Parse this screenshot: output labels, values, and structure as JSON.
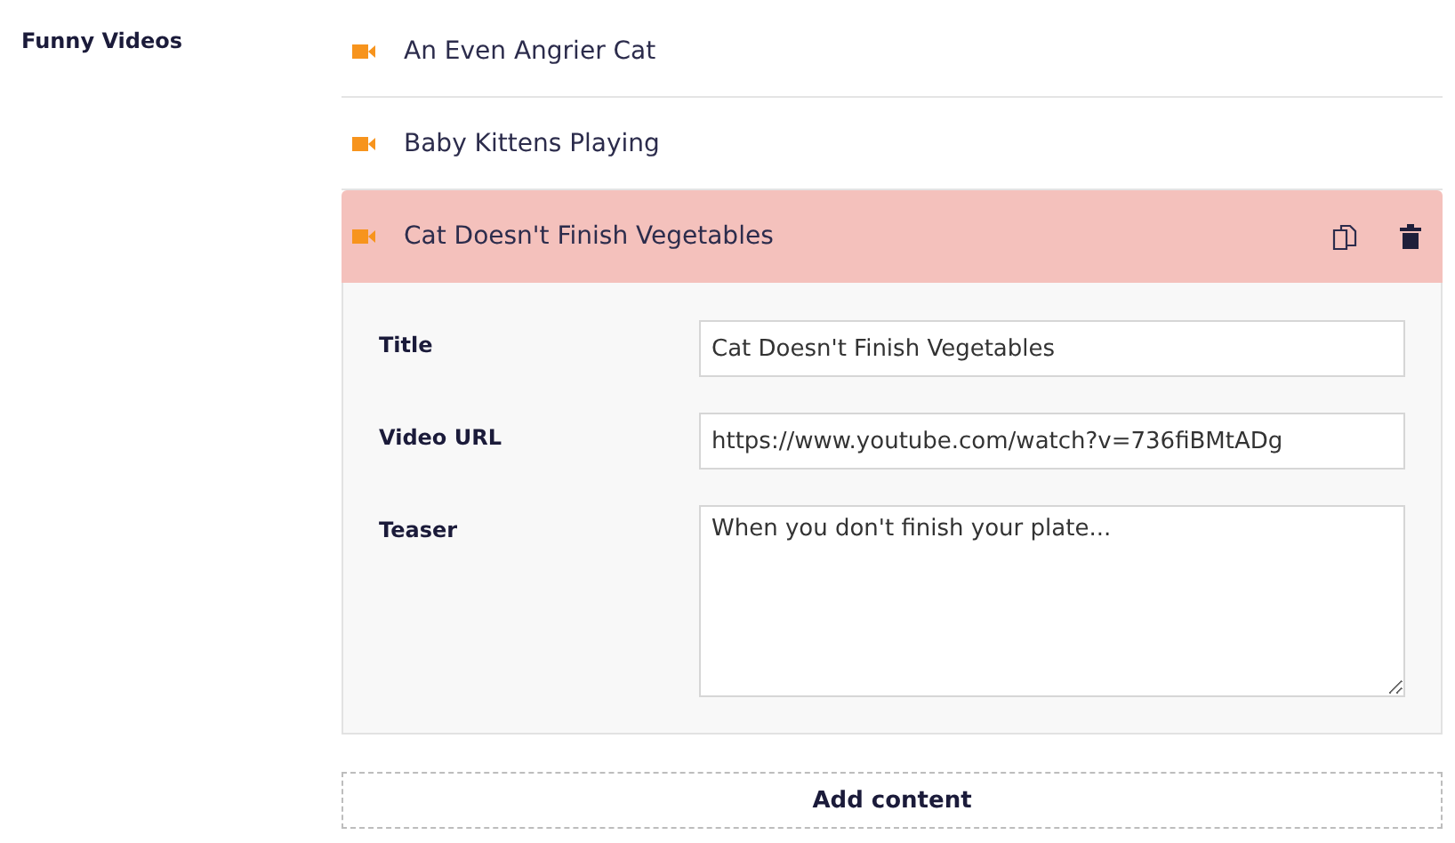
{
  "field_label": "Funny Videos",
  "items": [
    {
      "title": "An Even Angrier Cat",
      "expanded": false
    },
    {
      "title": "Baby Kittens Playing",
      "expanded": false
    },
    {
      "title": "Cat Doesn't Finish Vegetables",
      "expanded": true,
      "fields": [
        {
          "label": "Title",
          "kind": "input",
          "value": "Cat Doesn't Finish Vegetables"
        },
        {
          "label": "Video URL",
          "kind": "input",
          "value": "https://www.youtube.com/watch?v=736fiBMtADg"
        },
        {
          "label": "Teaser",
          "kind": "textarea",
          "value": "When you don't finish your plate..."
        }
      ]
    }
  ],
  "add_button": "Add content"
}
